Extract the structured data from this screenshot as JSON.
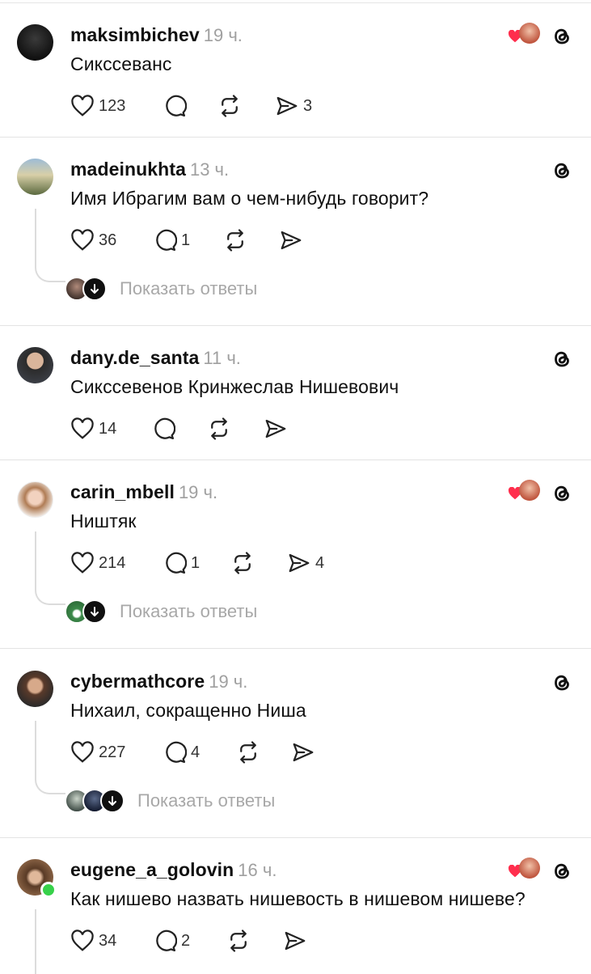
{
  "posts": [
    {
      "username": "maksimbichev",
      "time": "19 ч.",
      "text": "Сикссеванс",
      "likes": "123",
      "comments": "",
      "shares": "3",
      "liked_by_author": true,
      "show_replies": ""
    },
    {
      "username": "madeinukhta",
      "time": "13 ч.",
      "text": "Имя Ибрагим вам о чем-нибудь говорит?",
      "likes": "36",
      "comments": "1",
      "shares": "",
      "liked_by_author": false,
      "show_replies": "Показать ответы"
    },
    {
      "username": "dany.de_santa",
      "time": "11 ч.",
      "text": "Сикссевенов Кринжеслав Нишевович",
      "likes": "14",
      "comments": "",
      "shares": "",
      "liked_by_author": false,
      "show_replies": ""
    },
    {
      "username": "carin_mbell",
      "time": "19 ч.",
      "text": "Ништяк",
      "likes": "214",
      "comments": "1",
      "shares": "4",
      "liked_by_author": true,
      "show_replies": "Показать ответы"
    },
    {
      "username": "cybermathcore",
      "time": "19 ч.",
      "text": "Нихаил, сокращенно Ниша",
      "likes": "227",
      "comments": "4",
      "shares": "",
      "liked_by_author": false,
      "show_replies": "Показать ответы"
    },
    {
      "username": "eugene_a_golovin",
      "time": "16 ч.",
      "text": "Как нишево назвать нишевость в нишевом нишеве?",
      "likes": "34",
      "comments": "2",
      "shares": "",
      "liked_by_author": true,
      "show_replies": ""
    }
  ],
  "icons": {
    "like": "heart-outline-icon",
    "comment": "comment-bubble-icon",
    "repost": "repost-icon",
    "share": "send-icon",
    "threads": "threads-logo-icon",
    "liked": "red-heart-icon",
    "expand": "arrow-down-icon"
  },
  "colors": {
    "liked_heart": "#ff2e4d",
    "online": "#37d14a",
    "muted": "#a0a0a0"
  }
}
